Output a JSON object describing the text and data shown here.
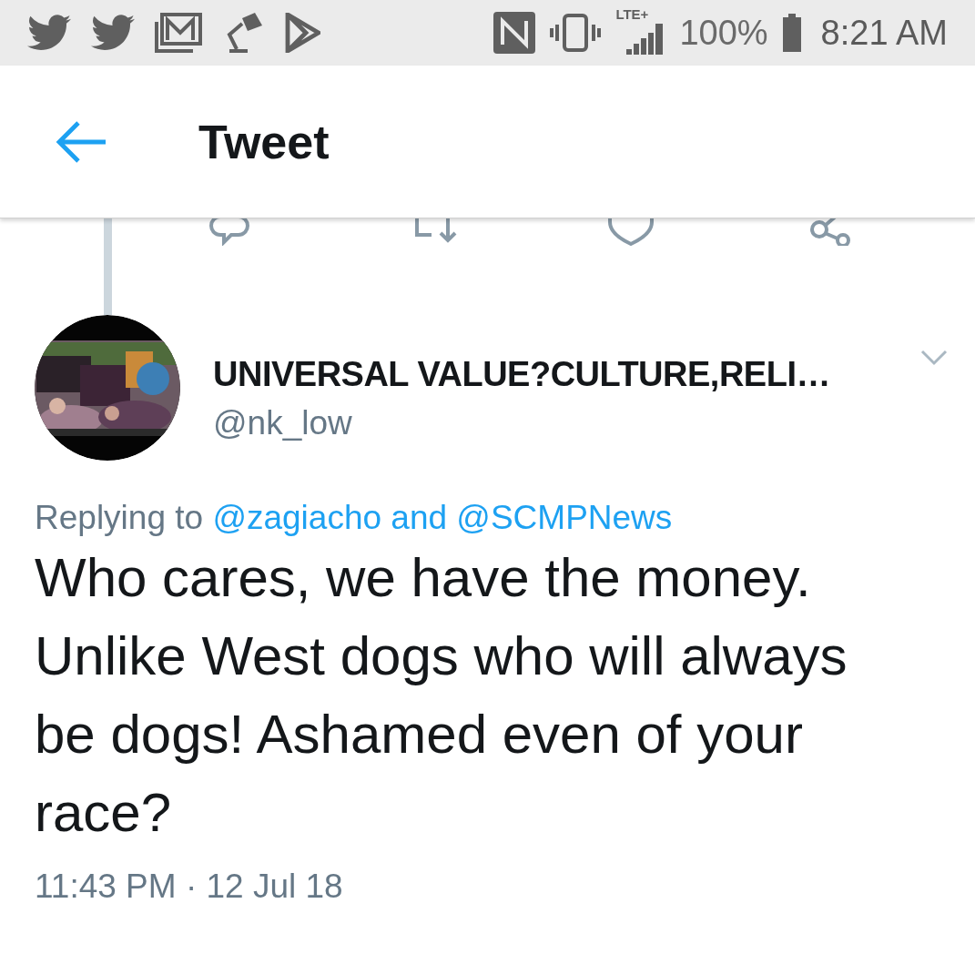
{
  "status_bar": {
    "network": "LTE+",
    "battery": "100%",
    "time": "8:21 AM"
  },
  "header": {
    "title": "Tweet"
  },
  "tweet": {
    "name": "UNIVERSAL VALUE?CULTURE,RELI…",
    "handle": "@nk_low",
    "reply_prefix": "Replying to",
    "reply_to": "@zagiacho and @SCMPNews",
    "text": "Who cares, we have the money. Unlike West dogs who will always be dogs! Ashamed even of your race?",
    "timestamp": "11:43 PM · 12 Jul 18"
  }
}
